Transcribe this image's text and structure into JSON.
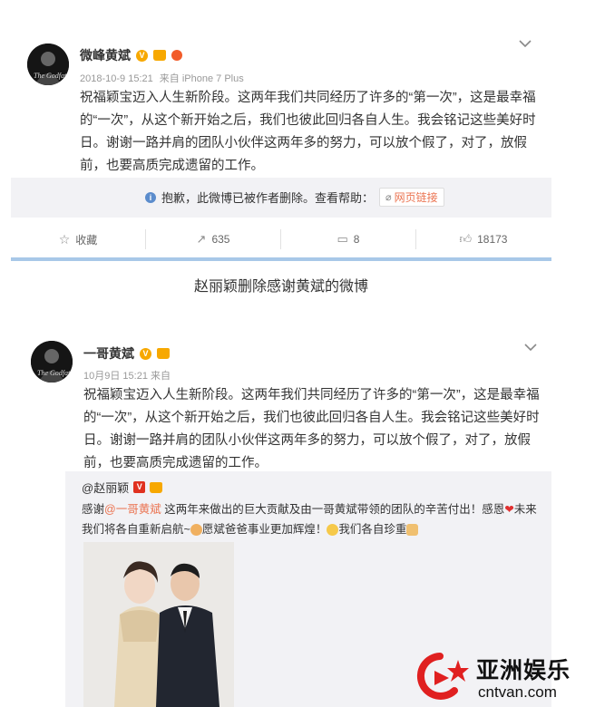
{
  "post1": {
    "username": "微峰黄斌",
    "timestamp": "2018-10-9 15:21",
    "source": "来自 iPhone 7 Plus",
    "content_lines": [
      "祝福颖宝迈入人生新阶段。这两年我们共同经历了许多的“第一次”，这是最幸福",
      "的“一次”，从这个新开始之后，我们也彼此回归各自人生。我会铭记这些美好时",
      "日。谢谢一路并肩的团队小伙伴这两年多的努力，可以放个假了，对了，放假",
      "前，也要高质完成遗留的工作。"
    ],
    "deleted_notice": "抱歉，此微博已被作者删除。查看帮助：",
    "web_link_label": "网页链接",
    "actions": {
      "favorite": "收藏",
      "repost": "635",
      "comment": "8",
      "like": "18173"
    }
  },
  "caption": "赵丽颖删除感谢黄斌的微博",
  "post2": {
    "username": "一哥黄斌",
    "timestamp": "10月9日 15:21 来自",
    "content_lines": [
      "祝福颖宝迈入人生新阶段。这两年我们共同经历了许多的“第一次”，这是最幸福",
      "的“一次”，从这个新开始之后，我们也彼此回归各自人生。我会铭记这些美好时",
      "日。谢谢一路并肩的团队小伙伴这两年多的努力，可以放个假了，对了，放假",
      "前，也要高质完成遗留的工作。"
    ],
    "repost": {
      "author": "@赵丽颖",
      "line1_prefix": "感谢",
      "line1_mention": "@一哥黄斌",
      "line1_rest": "这两年来做出的巨大贡献及由一哥黄斌带领的团队的辛苦付出！感恩",
      "line1_end": "未来",
      "line2_a": "我们将各自重新启航~",
      "line2_b": "愿斌爸爸事业更加辉煌！",
      "line2_c": "我们各自珍重"
    }
  },
  "watermark": {
    "brand": "亚洲娱乐",
    "domain": "cntvan.com"
  },
  "colors": {
    "accent_orange": "#eb7350",
    "vip_gold": "#f7a800",
    "blue_divider": "#a8c8e8",
    "watermark_red": "#e02020"
  }
}
